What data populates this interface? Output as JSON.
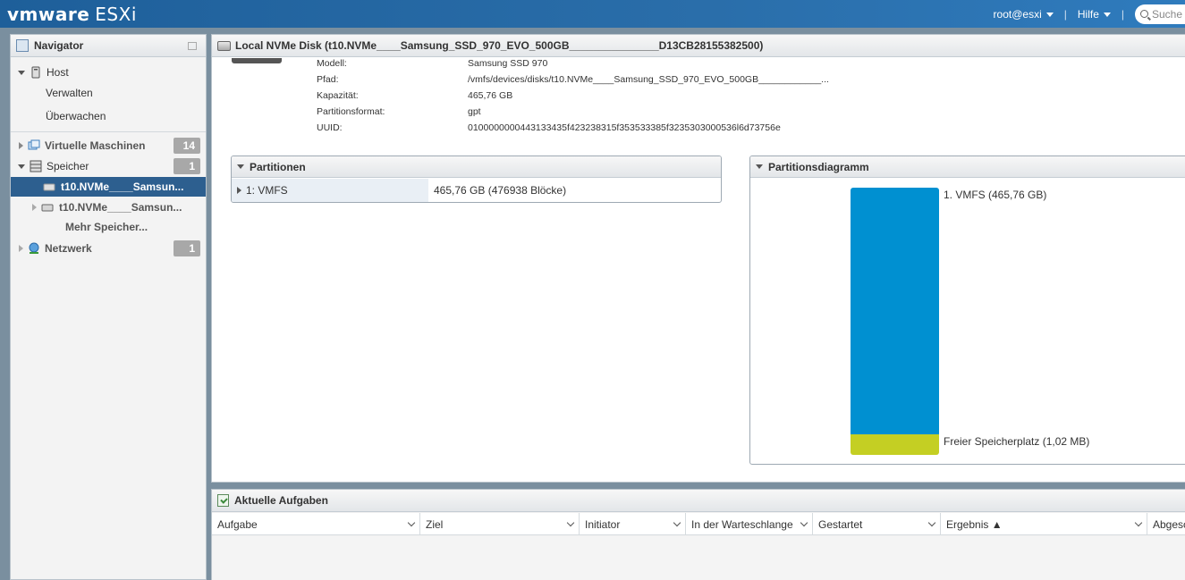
{
  "topbar": {
    "logo_brand": "vmware",
    "logo_product": "ESXi",
    "user": "root@esxi",
    "help": "Hilfe",
    "search_placeholder": "Suche"
  },
  "navigator": {
    "title": "Navigator",
    "host": {
      "label": "Host",
      "children": [
        "Verwalten",
        "Überwachen"
      ]
    },
    "vms": {
      "label": "Virtuelle Maschinen",
      "count": "14"
    },
    "storage": {
      "label": "Speicher",
      "count": "1",
      "children": [
        "t10.NVMe____Samsun...",
        "t10.NVMe____Samsun..."
      ],
      "more": "Mehr Speicher..."
    },
    "network": {
      "label": "Netzwerk",
      "count": "1"
    }
  },
  "disk": {
    "title": "Local NVMe Disk (t10.NVMe____Samsung_SSD_970_EVO_500GB_______________D13CB28155382500)",
    "properties": [
      {
        "label": "Modell:",
        "value": "Samsung SSD 970"
      },
      {
        "label": "Pfad:",
        "value": "/vmfs/devices/disks/t10.NVMe____Samsung_SSD_970_EVO_500GB____________..."
      },
      {
        "label": "Kapazität:",
        "value": "465,76 GB"
      },
      {
        "label": "Partitionsformat:",
        "value": "gpt"
      },
      {
        "label": "UUID:",
        "value": "0100000000443133435f423238315f353533385f3235303000536l6d73756e"
      }
    ]
  },
  "partitions": {
    "title": "Partitionen",
    "rows": [
      {
        "name": "1: VMFS",
        "size": "465,76 GB (476938 Blöcke)"
      }
    ]
  },
  "diagram": {
    "title": "Partitionsdiagramm",
    "segments": [
      {
        "label": "1. VMFS  (465,76 GB)",
        "color": "#0090d1"
      },
      {
        "label": "Freier Speicherplatz  (1,02 MB)",
        "color": "#c4cf23"
      }
    ]
  },
  "tasks": {
    "title": "Aktuelle Aufgaben",
    "columns": [
      "Aufgabe",
      "Ziel",
      "Initiator",
      "In der Warteschlange",
      "Gestartet",
      "Ergebnis ▲",
      "Abgeschl"
    ]
  }
}
